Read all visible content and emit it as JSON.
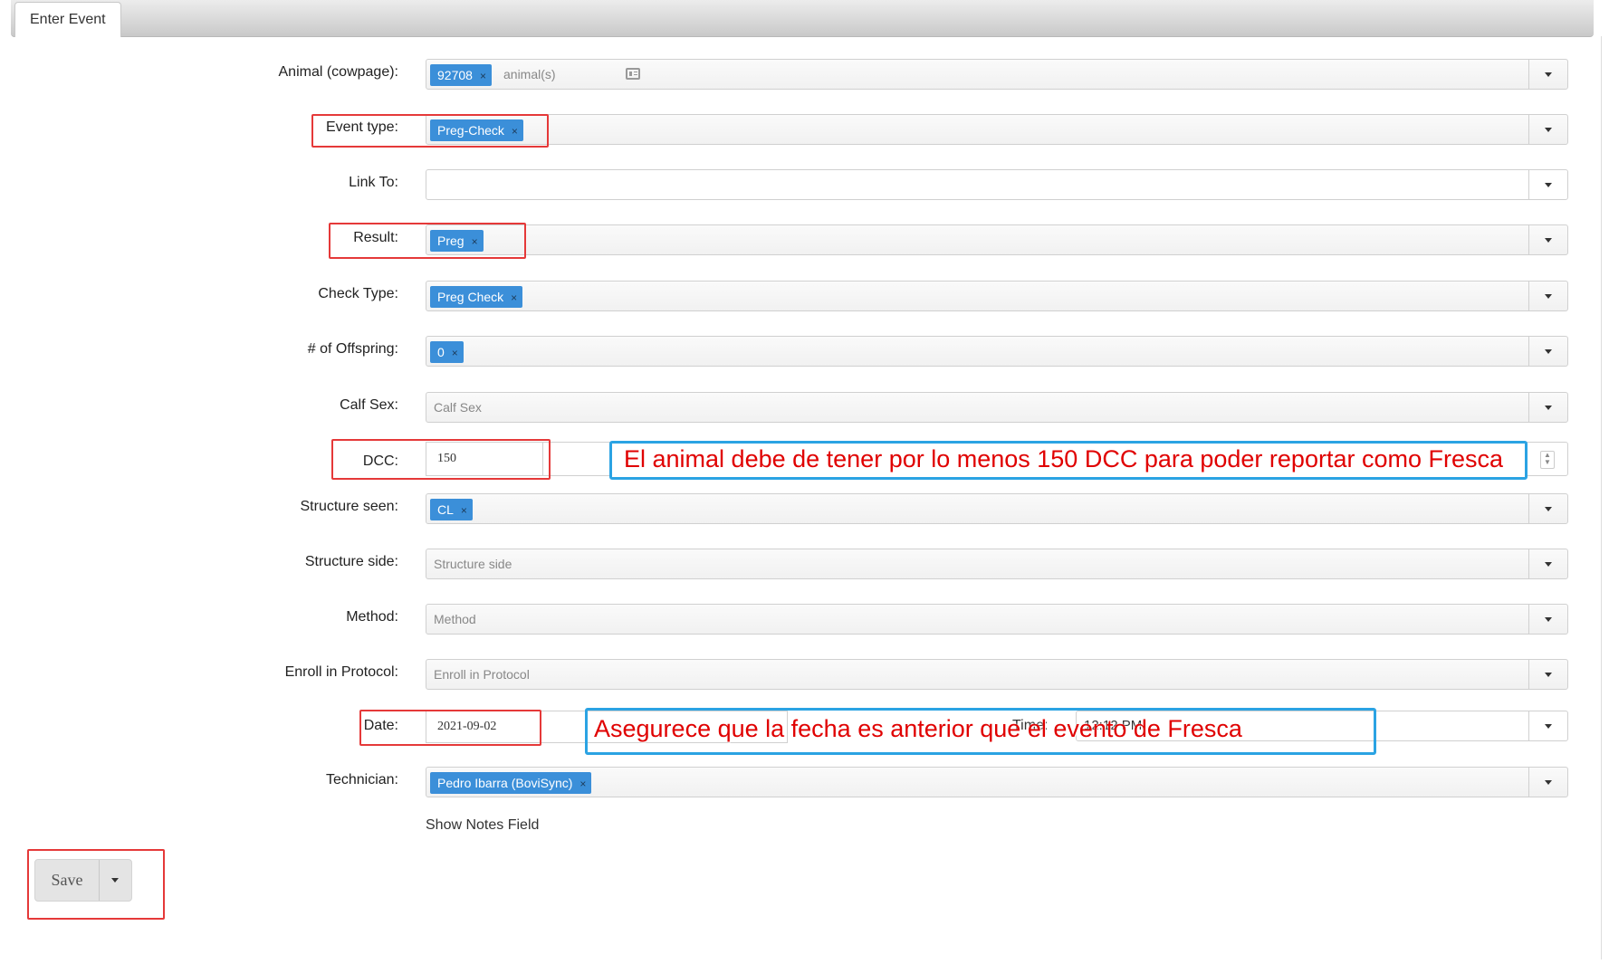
{
  "tab": {
    "label": "Enter Event"
  },
  "animal": {
    "label": "Animal (cowpage):",
    "chip": "92708",
    "placeholder": "animal(s)"
  },
  "event_type": {
    "label": "Event type:",
    "chip": "Preg-Check"
  },
  "link_to": {
    "label": "Link To:"
  },
  "result": {
    "label": "Result:",
    "chip": "Preg"
  },
  "check_type": {
    "label": "Check Type:",
    "chip": "Preg Check"
  },
  "offspring": {
    "label": "# of Offspring:",
    "chip": "0"
  },
  "calf_sex": {
    "label": "Calf Sex:",
    "placeholder": "Calf Sex"
  },
  "dcc": {
    "label": "DCC:",
    "value": "150"
  },
  "structure_seen": {
    "label": "Structure seen:",
    "chip": "CL"
  },
  "structure_side": {
    "label": "Structure side:",
    "placeholder": "Structure side"
  },
  "method": {
    "label": "Method:",
    "placeholder": "Method"
  },
  "enroll": {
    "label": "Enroll in Protocol:",
    "placeholder": "Enroll in Protocol"
  },
  "date": {
    "label": "Date:",
    "value": "2021-09-02",
    "time_label": "Time:",
    "time_value": "12:12 PM"
  },
  "technician": {
    "label": "Technician:",
    "chip": "Pedro Ibarra (BoviSync)"
  },
  "notes": {
    "label": "Show Notes Field"
  },
  "save": {
    "label": "Save"
  },
  "annotations": {
    "dcc_note": "El animal debe de tener por lo menos 150 DCC para poder reportar como Fresca",
    "date_note": "Asegurece que la fecha es anterior que el evento de Fresca"
  },
  "colors": {
    "chip": "#3b8fd9",
    "red_box": "#e53939",
    "blue_box": "#2ba3e3",
    "annotation_text": "#e00000"
  },
  "chip_remove_glyph": "×"
}
